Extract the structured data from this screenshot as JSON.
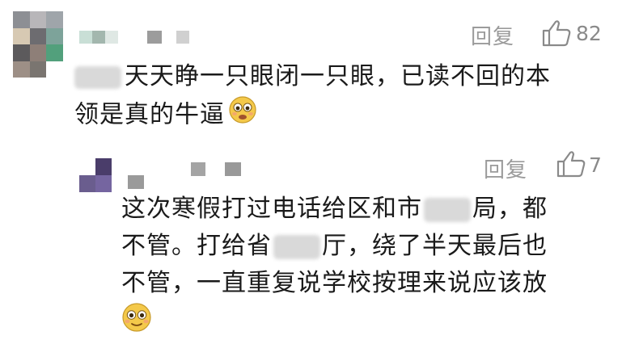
{
  "comments": [
    {
      "reply_label": "回复",
      "like_count": "82",
      "text_line1_pre": "",
      "text_line1_post": "天天睁一只眼闭一只眼，已读不回的本",
      "text_line2": "领是真的牛逼",
      "emoji": "woozy-face-icon"
    },
    {
      "reply_label": "回复",
      "like_count": "7",
      "text_line1_pre": "这次寒假打过电话给区和市",
      "text_line1_post": "局，都",
      "text_line2_pre": "不管。打给省",
      "text_line2_post": "厅，绕了半天最后也",
      "text_line3": "不管，一直重复说学校按理来说应该放",
      "emoji": "flushed-face-icon"
    }
  ],
  "colors": {
    "text": "#1a1a1a",
    "meta": "#9b9b9b",
    "emoji": "#f4c94a"
  }
}
